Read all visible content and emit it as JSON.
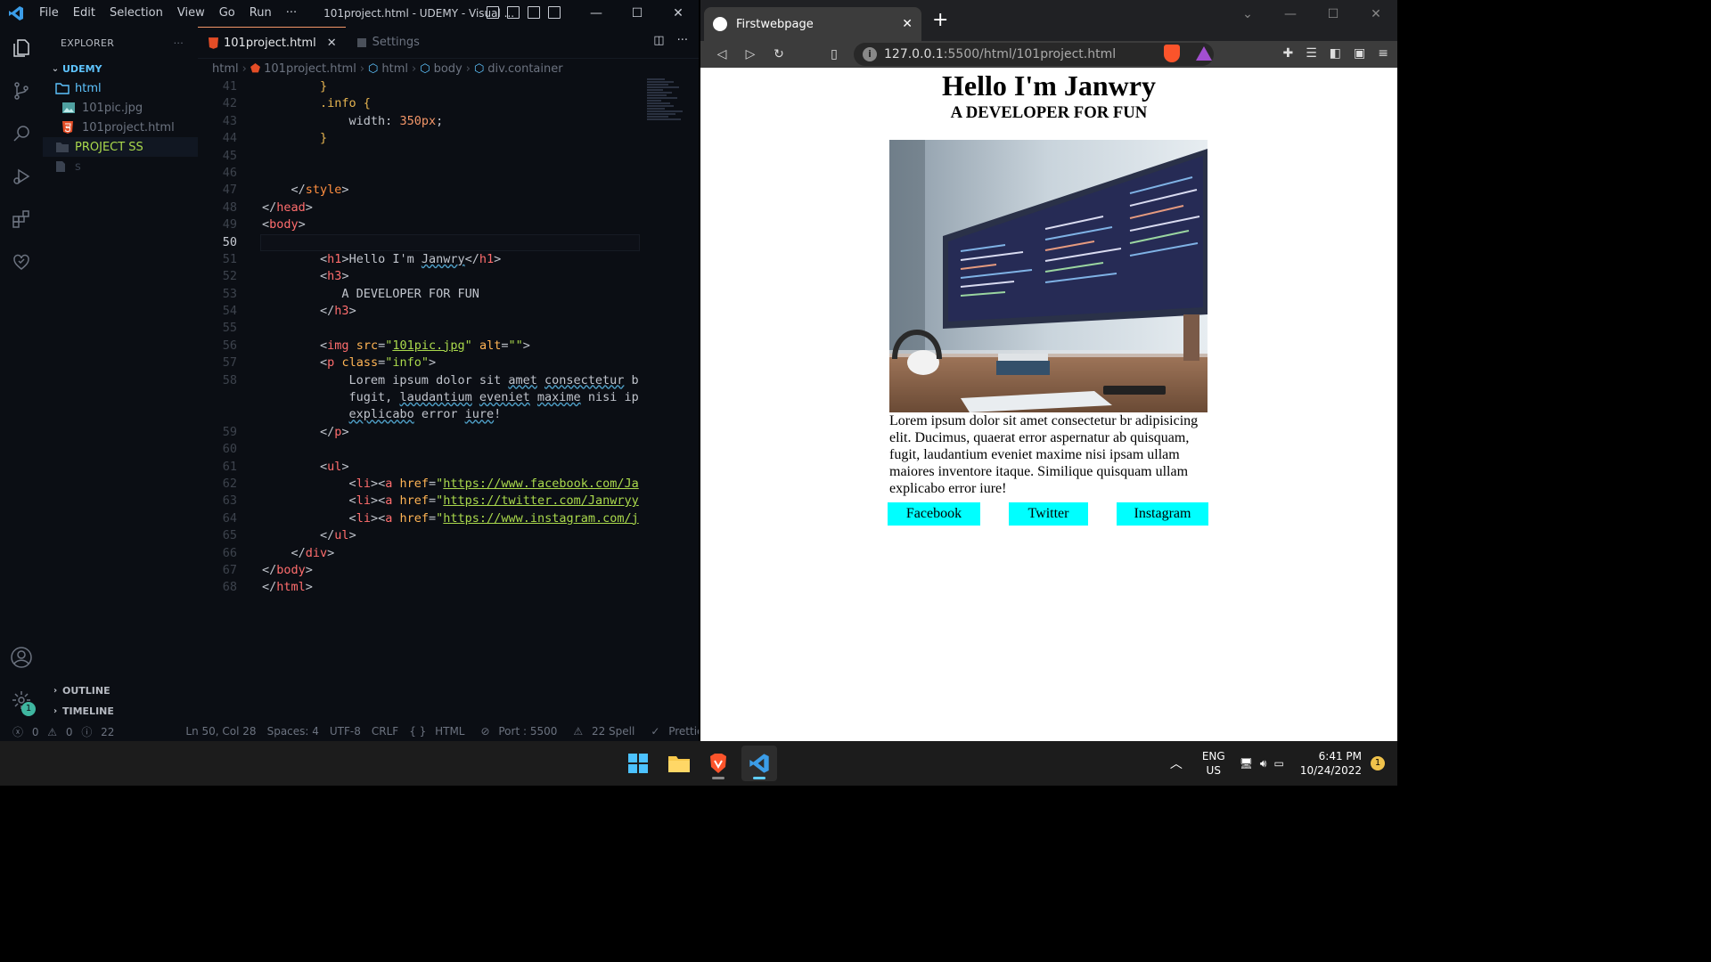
{
  "vscode": {
    "menu": [
      "File",
      "Edit",
      "Selection",
      "View",
      "Go",
      "Run",
      "···"
    ],
    "window_title": "101project.html - UDEMY - Visual ...",
    "explorer_label": "EXPLORER",
    "workspace": "UDEMY",
    "tree": [
      {
        "label": "html",
        "kind": "folder"
      },
      {
        "label": "101pic.jpg",
        "kind": "image"
      },
      {
        "label": "101project.html",
        "kind": "html"
      },
      {
        "label": "PROJECT SS",
        "kind": "folder"
      },
      {
        "label": "s",
        "kind": "file"
      }
    ],
    "outline_label": "OUTLINE",
    "timeline_label": "TIMELINE",
    "settings_badge": "1",
    "tabs": [
      {
        "label": "101project.html",
        "active": true
      },
      {
        "label": "Settings",
        "active": false
      }
    ],
    "breadcrumb": [
      "html",
      "101project.html",
      "html",
      "body",
      "div.container"
    ],
    "status": {
      "errors": "0",
      "warnings": "0",
      "infos": "22",
      "position": "Ln 50, Col 28",
      "spaces": "Spaces: 4",
      "encoding": "UTF-8",
      "eol": "CRLF",
      "language": "HTML",
      "port": "Port : 5500",
      "spell": "22 Spell",
      "formatter": "Prettier"
    }
  },
  "browser": {
    "tab_title": "Firstwebpage",
    "url_host": "127.0.0.1",
    "url_path": ":5500/html/101project.html",
    "page": {
      "h1": "Hello I'm Janwry",
      "h3": "A DEVELOPER FOR FUN",
      "paragraph": "Lorem ipsum dolor sit amet consectetur br adipisicing elit. Ducimus, quaerat error aspernatur ab quisquam, fugit, laudantium eveniet maxime nisi ipsam ullam maiores inventore itaque. Similique quisquam ullam explicabo error iure!",
      "links": [
        "Facebook",
        "Twitter",
        "Instagram"
      ]
    }
  },
  "taskbar": {
    "lang_top": "ENG",
    "lang_bottom": "US",
    "time": "6:41 PM",
    "date": "10/24/2022",
    "notification_count": "1"
  },
  "colors": {
    "link_bg": "#00ffff",
    "vscode_bg": "#0b0e14",
    "active_tab_border": "#f29668"
  }
}
